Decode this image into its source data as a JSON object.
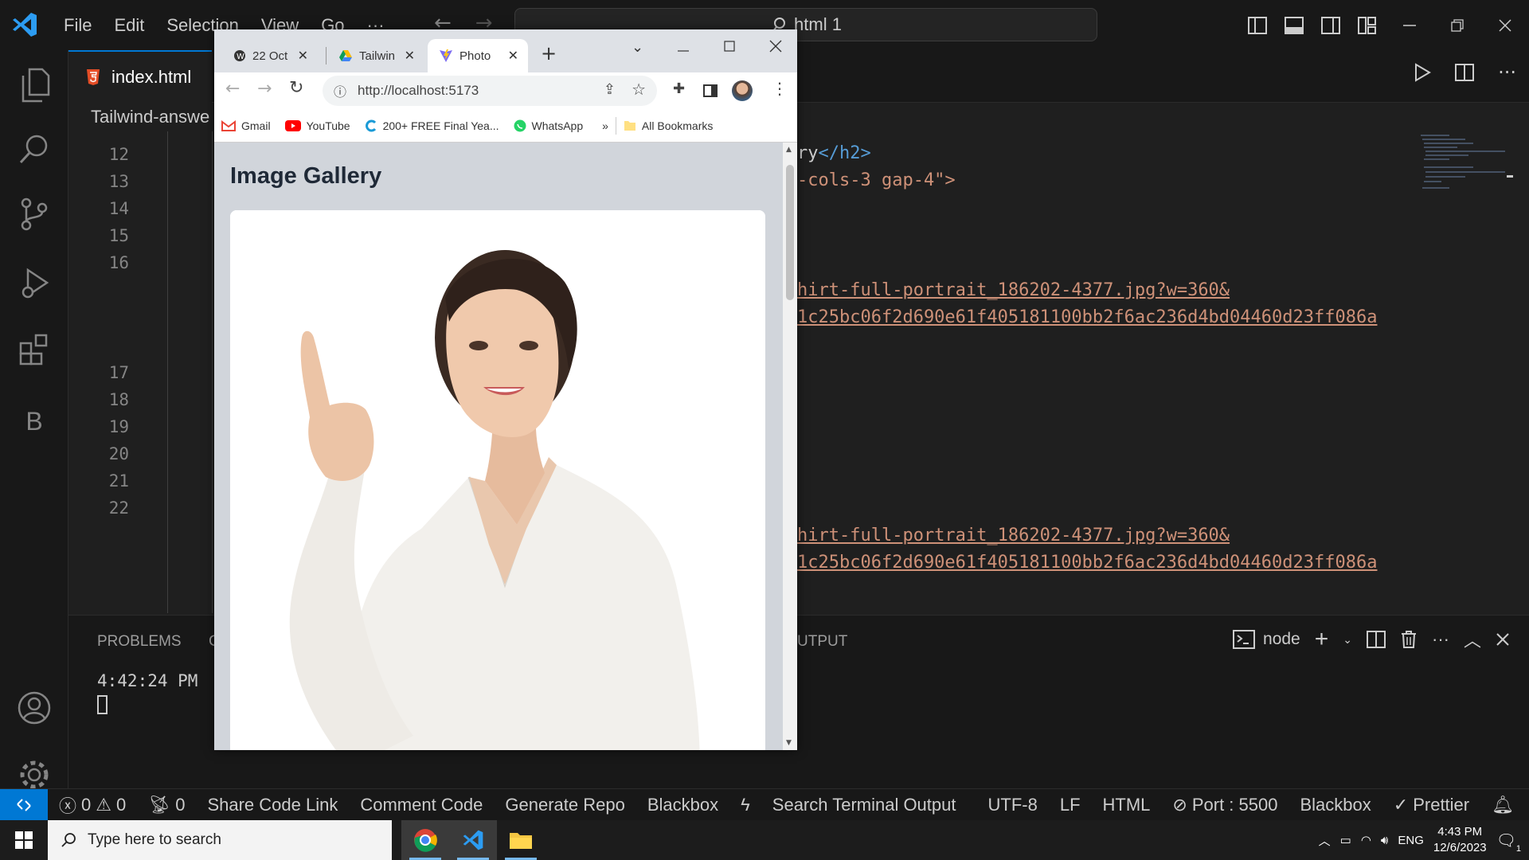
{
  "vscode": {
    "menu": [
      "File",
      "Edit",
      "Selection",
      "View",
      "Go",
      "···"
    ],
    "command_center": "html 1",
    "tab": {
      "label": "index.html"
    },
    "breadcrumb": "Tailwind-answe",
    "line_numbers": [
      "12",
      "13",
      "14",
      "15",
      "16",
      "17",
      "18",
      "19",
      "20",
      "21",
      "22"
    ],
    "code_lines": [
      {
        "text": "ry",
        "tail": "</h2>"
      },
      {
        "text": "-cols-3 gap-4\">"
      },
      {
        "text": "hirt-full-portrait_186202-4377.jpg?w=360&"
      },
      {
        "text": "1c25bc06f2d690e61f405181100bb2f6ac236d4bd04460d23ff086a"
      },
      {
        "text": "hirt-full-portrait_186202-4377.jpg?w=360&"
      },
      {
        "text": "1c25bc06f2d690e61f405181100bb2f6ac236d4bd04460d23ff086a"
      }
    ],
    "panel": {
      "problems": "PROBLEMS",
      "second_tab": "C",
      "output": "UTPUT",
      "terminal_name": "node",
      "terminal_time": "4:42:24 PM"
    },
    "status": {
      "errors": "0",
      "warnings": "0",
      "ports": "0",
      "share": "Share Code Link",
      "comment": "Comment Code",
      "generate": "Generate Repo",
      "blackbox": "Blackbox",
      "search_terminal": "Search Terminal Output",
      "encoding": "UTF-8",
      "eol": "LF",
      "language": "HTML",
      "port": "Port : 5500",
      "blackbox2": "Blackbox",
      "prettier": "Prettier"
    }
  },
  "chrome": {
    "tabs": [
      {
        "label": "22 Oct"
      },
      {
        "label": "Tailwin"
      },
      {
        "label": "Photo"
      }
    ],
    "url": "http://localhost:5173",
    "bookmarks": [
      "Gmail",
      "YouTube",
      "200+ FREE Final Yea...",
      "WhatsApp"
    ],
    "more": "»",
    "all_bookmarks": "All Bookmarks",
    "page": {
      "title": "Image Gallery"
    }
  },
  "taskbar": {
    "search_placeholder": "Type here to search",
    "lang": "ENG",
    "time": "4:43 PM",
    "date": "12/6/2023",
    "notifications": "1"
  },
  "colors": {
    "accent": "#0078d4",
    "code_string": "#ce9178",
    "code_tag": "#569cd6"
  }
}
